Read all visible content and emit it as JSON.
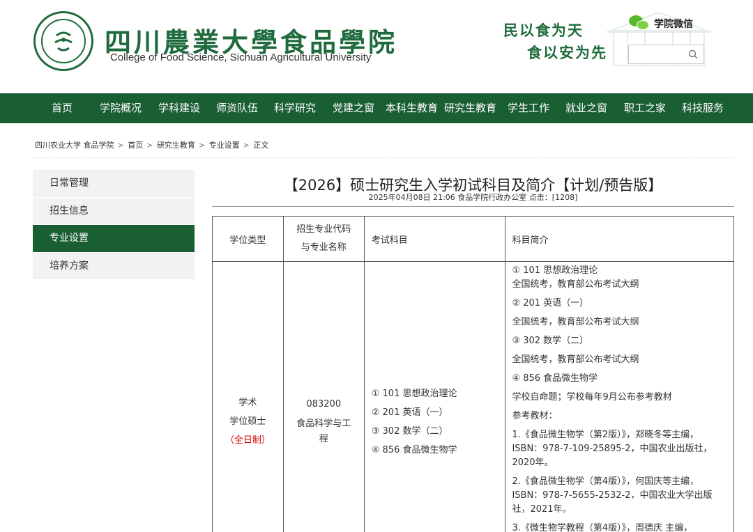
{
  "header": {
    "title": "四川農業大學食品學院",
    "subtitle": "College of Food Science, Sichuan Agricultural University",
    "motto_line1": "民以食为天",
    "motto_line2": "食以安为先",
    "wechat_label": "学院微信",
    "search_placeholder": ""
  },
  "nav": {
    "items": [
      "首页",
      "学院概况",
      "学科建设",
      "师资队伍",
      "科学研究",
      "党建之窗",
      "本科生教育",
      "研究生教育",
      "学生工作",
      "就业之窗",
      "职工之家",
      "科技服务"
    ]
  },
  "breadcrumb": [
    "四川农业大学 食品学院",
    "首页",
    "研究生教育",
    "专业设置",
    "正文"
  ],
  "sidebar": {
    "items": [
      "日常管理",
      "招生信息",
      "专业设置",
      "培养方案"
    ],
    "active": "专业设置"
  },
  "article": {
    "title": "【2026】硕士研究生入学初试科目及简介【计划/预告版】",
    "meta": "2025年04月08日 21:06 食品学院行政办公室 点击：[1208]"
  },
  "table": {
    "headers": {
      "col1": "学位类型",
      "col2_line1": "招生专业代码",
      "col2_line2": "与专业名称",
      "col3": "考试科目",
      "col4": "科目简介"
    },
    "row1": {
      "degree_line1": "学术",
      "degree_line2": "学位硕士",
      "degree_line3": "（全日制）",
      "major_code": "083200",
      "major_name_line1": "食品科学与工",
      "major_name_line2": "程",
      "subjects": [
        "① 101 思想政治理论",
        "② 201 英语（一）",
        "③ 302 数学（二）",
        "④ 856 食品微生物学"
      ],
      "intro": [
        "① 101 思想政治理论",
        "全国统考，教育部公布考试大纲",
        "② 201 英语（一）",
        "全国统考，教育部公布考试大纲",
        "③ 302 数学（二）",
        "全国统考，教育部公布考试大纲",
        "④ 856 食品微生物学",
        "学校自命题；学校每年9月公布参考教材",
        "参考教材：",
        "1.《食品微生物学（第2版）》，郑晓冬等主编，ISBN：978-7-109-25895-2，中国农业出版社，2020年。",
        "2.《食品微生物学（第4版）》，何国庆等主编，ISBN：978-7-5655-2532-2，中国农业大学出版社，2021年。",
        "3.《微生物学教程（第4版）》，周德庆 主编，"
      ]
    }
  }
}
